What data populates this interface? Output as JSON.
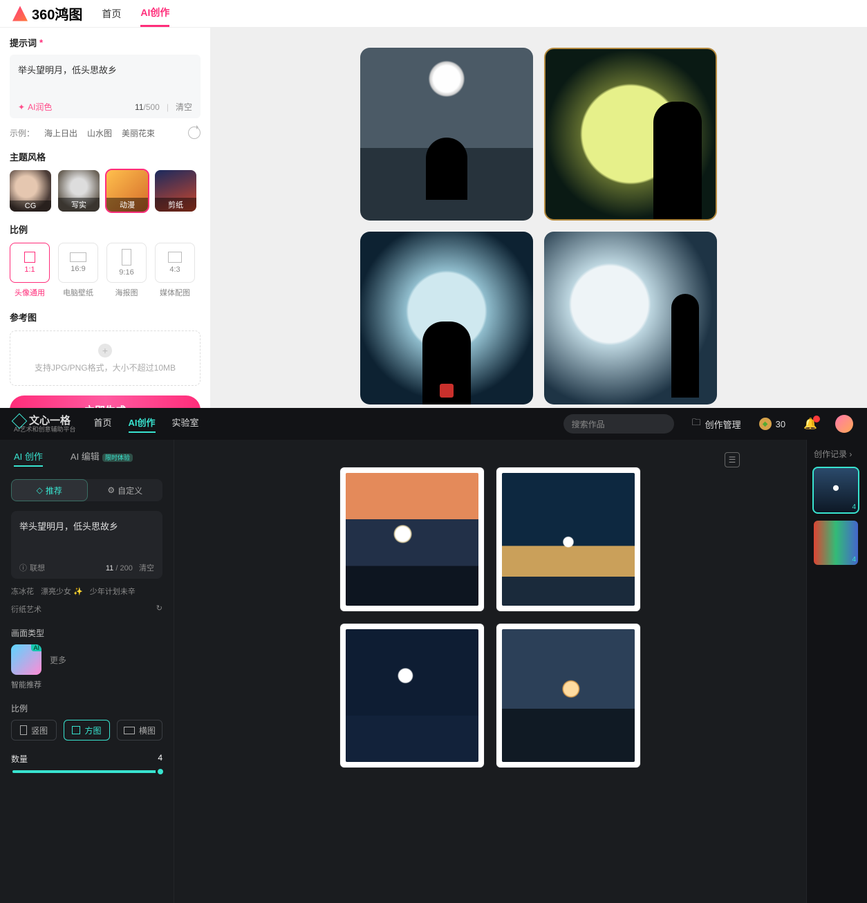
{
  "top": {
    "brand": "360鸿图",
    "nav": {
      "home": "首页",
      "ai_create": "AI创作"
    },
    "sidebar": {
      "prompt_label": "提示词",
      "prompt_value": "举头望明月，低头思故乡",
      "ai_polish": "AI润色",
      "count": "11",
      "count_max": "/500",
      "clear": "清空",
      "examples_label": "示例：",
      "examples": [
        "海上日出",
        "山水图",
        "美丽花束"
      ],
      "style_title": "主题风格",
      "styles": [
        {
          "label": "CG"
        },
        {
          "label": "写实"
        },
        {
          "label": "动漫"
        },
        {
          "label": "剪纸"
        }
      ],
      "ratio_title": "比例",
      "ratios": [
        {
          "label": "1:1",
          "caption": "头像通用"
        },
        {
          "label": "16:9",
          "caption": "电脑壁纸"
        },
        {
          "label": "9:16",
          "caption": "海报图"
        },
        {
          "label": "4:3",
          "caption": "媒体配图"
        }
      ],
      "ref_title": "参考图",
      "ref_hint": "支持JPG/PNG格式，大小不超过10MB",
      "generate": "立即生成"
    }
  },
  "bottom": {
    "brand_title": "文心一格",
    "brand_sub": "AI艺术和创意辅助平台",
    "nav": {
      "home": "首页",
      "ai_create": "AI创作",
      "lab": "实验室"
    },
    "search_placeholder": "搜索作品",
    "manage": "创作管理",
    "coins": "30",
    "sub_tabs": {
      "create": "AI 创作",
      "edit": "AI 编辑",
      "badge": "限时体验"
    },
    "segment": {
      "recommend": "推荐",
      "custom": "自定义"
    },
    "prompt_value": "举头望明月，低头思故乡",
    "assoc": "联想",
    "count": "11",
    "count_max": " / 200",
    "clear": "清空",
    "examples": [
      "冻冰花",
      "漂亮少女 ✨",
      "少年计划未辛",
      "衍纸艺术"
    ],
    "type_title": "画面类型",
    "type_ai": "AI",
    "type_more": "更多",
    "type_caption": "智能推荐",
    "ratio_title": "比例",
    "ratios": {
      "v": "竖图",
      "sq": "方图",
      "h": "横图"
    },
    "qty_label": "数量",
    "qty_value": "4",
    "right_header": "创作记录",
    "thumb_count": "4"
  }
}
